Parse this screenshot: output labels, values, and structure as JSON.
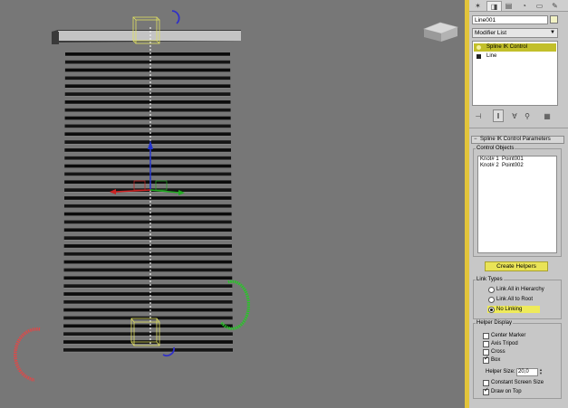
{
  "command_panel": {
    "tabs": [
      {
        "name": "create",
        "icon": "✶"
      },
      {
        "name": "modify",
        "icon": "◨"
      },
      {
        "name": "hierarchy",
        "icon": "▤"
      },
      {
        "name": "motion",
        "icon": "◔"
      },
      {
        "name": "display",
        "icon": "▭"
      },
      {
        "name": "utilities",
        "icon": "✎"
      }
    ],
    "object_name": "Line001",
    "object_color": "#f2f2c4",
    "modifier_list_label": "Modifier List",
    "modifier_stack": [
      {
        "label": "Spline IK Control",
        "selected": true
      },
      {
        "label": "Line",
        "selected": false
      }
    ],
    "stack_tools": [
      {
        "name": "pin-stack",
        "icon": "⊣"
      },
      {
        "name": "show-end-result",
        "icon": "‖"
      },
      {
        "name": "make-unique",
        "icon": "∀"
      },
      {
        "name": "remove-modifier",
        "icon": "⚲"
      },
      {
        "name": "configure-modifier-sets",
        "icon": "▦"
      }
    ],
    "rollout_title": "Spline IK Control Parameters",
    "control_objects_label": "Control Objects",
    "control_objects": [
      "Knot# 1  Point001",
      "Knot# 2  Point002"
    ],
    "create_helpers_label": "Create Helpers",
    "link_types": {
      "label": "Link Types",
      "options": [
        {
          "label": "Link All in Hierarchy",
          "checked": false,
          "highlighted": false
        },
        {
          "label": "Link All to Root",
          "checked": false,
          "highlighted": false
        },
        {
          "label": "No Linking",
          "checked": true,
          "highlighted": true
        }
      ]
    },
    "helper_display": {
      "label": "Helper Display",
      "checkboxes": [
        {
          "label": "Center Marker",
          "checked": false
        },
        {
          "label": "Axis Tripod",
          "checked": false
        },
        {
          "label": "Cross",
          "checked": false
        },
        {
          "label": "Box",
          "checked": true
        }
      ],
      "helper_size_label": "Helper Size:",
      "helper_size_value": "20,0",
      "bottom_checkboxes": [
        {
          "label": "Constant Screen Size",
          "checked": false
        },
        {
          "label": "Draw on Top",
          "checked": true
        }
      ]
    }
  },
  "viewport": {
    "background": "#777777",
    "slat_count": 38,
    "selection_color": "#e0e060",
    "gizmo_colors": {
      "x": "#cc2222",
      "y": "#22aa22",
      "z": "#2233cc",
      "rotate_blue": "#3030c8",
      "ring_green": "#22cc22",
      "ring_red": "#dd4444"
    }
  }
}
